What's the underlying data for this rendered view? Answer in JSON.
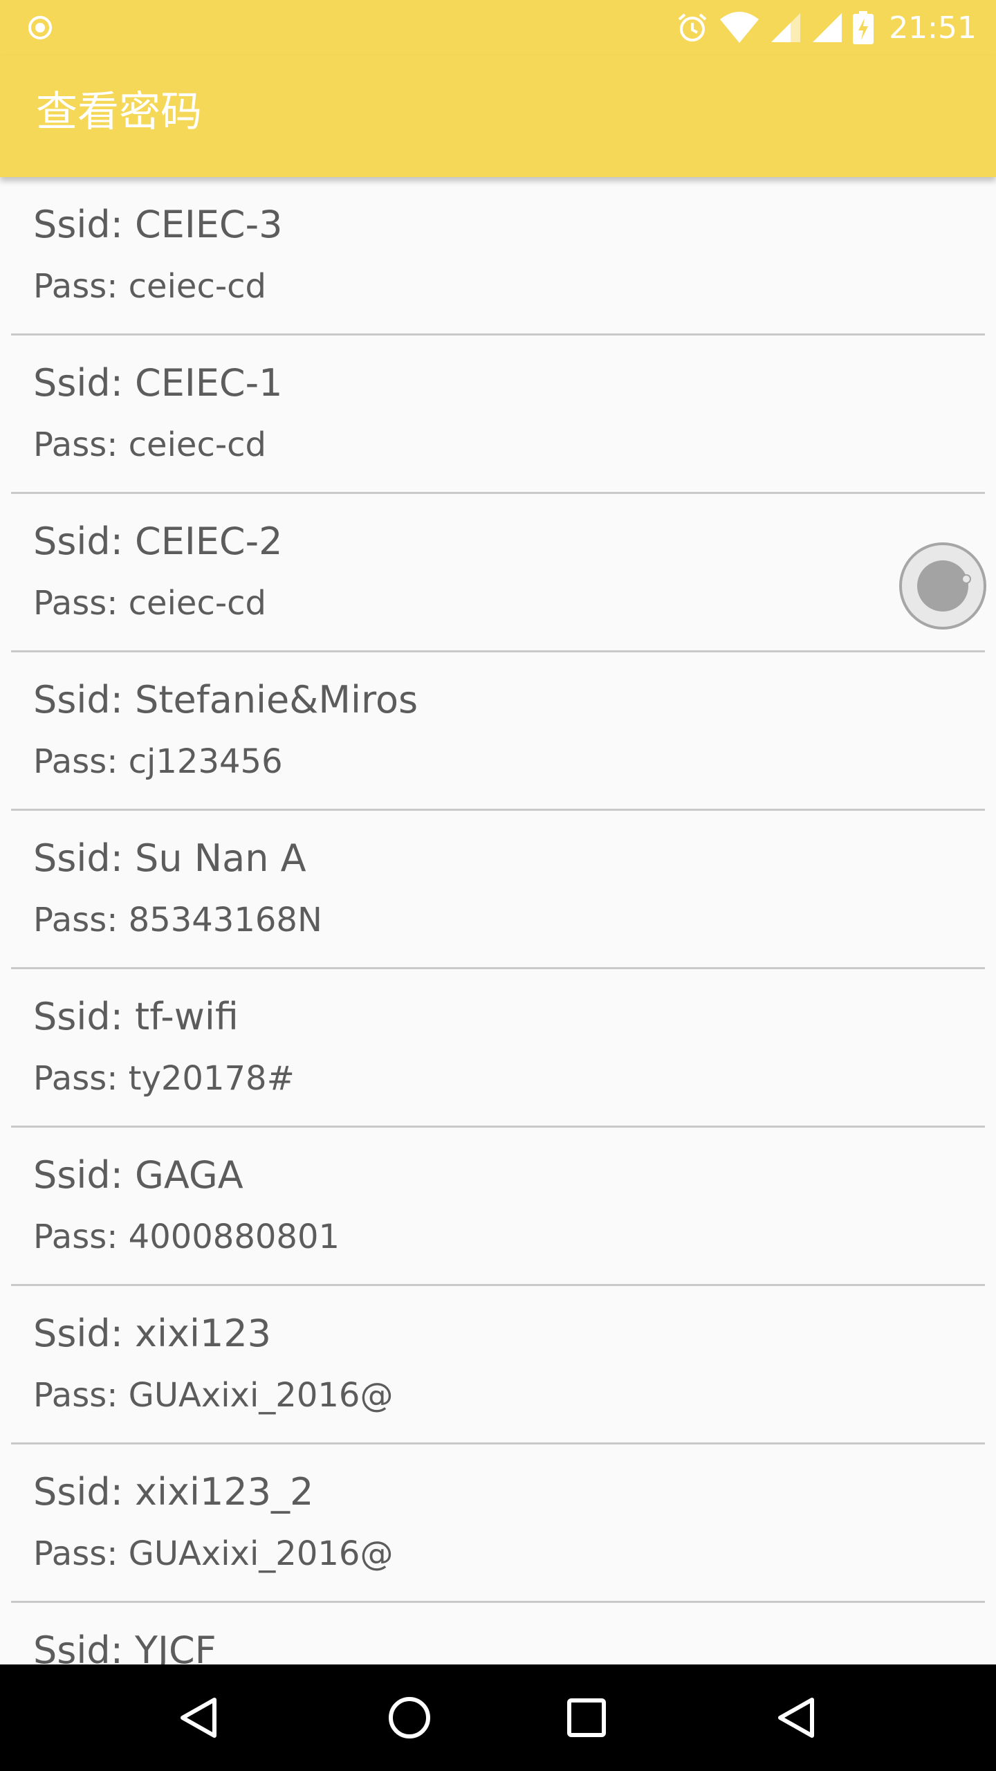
{
  "status_bar": {
    "time": "21:51",
    "icons": [
      "record-icon",
      "alarm-icon",
      "wifi-icon",
      "signal-icon",
      "signal-icon",
      "battery-charging-icon"
    ]
  },
  "app_bar": {
    "title": "查看密码"
  },
  "wifi_list": [
    {
      "ssid": "Ssid: CEIEC-3",
      "pass": "Pass: ceiec-cd"
    },
    {
      "ssid": "Ssid: CEIEC-1",
      "pass": "Pass: ceiec-cd"
    },
    {
      "ssid": "Ssid: CEIEC-2",
      "pass": "Pass: ceiec-cd"
    },
    {
      "ssid": "Ssid: Stefanie&Miros",
      "pass": "Pass: cj123456"
    },
    {
      "ssid": "Ssid: Su Nan A",
      "pass": "Pass: 85343168N"
    },
    {
      "ssid": "Ssid: tf-wifi",
      "pass": "Pass: ty20178#"
    },
    {
      "ssid": "Ssid: GAGA",
      "pass": "Pass: 4000880801"
    },
    {
      "ssid": "Ssid: xixi123",
      "pass": "Pass: GUAxixi_2016@"
    },
    {
      "ssid": "Ssid: xixi123_2",
      "pass": "Pass: GUAxixi_2016@"
    },
    {
      "ssid": "Ssid: YJCF",
      "pass": ""
    }
  ],
  "nav_bar": {
    "buttons": [
      "back-icon",
      "home-icon",
      "recents-icon",
      "back-icon"
    ]
  },
  "colors": {
    "accent": "#f6d858",
    "text": "#5c5c5c",
    "divider": "#c9c9c9"
  }
}
